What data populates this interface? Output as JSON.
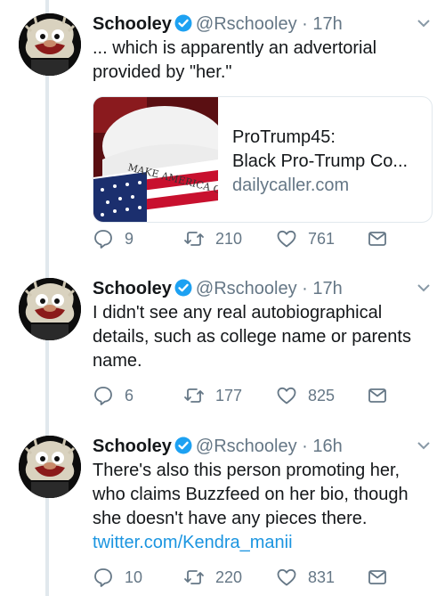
{
  "tweets": [
    {
      "name": "Schooley",
      "handle": "@Rschooley",
      "dot": "·",
      "time": "17h",
      "text_lines": [
        "... which is apparently an advertorial",
        "provided by \"her.\""
      ],
      "card": {
        "image_caption": "MAKE AMERICA GREAT AGAIN",
        "title_line1": "ProTrump45:",
        "title_line2": "Black Pro-Trump Co...",
        "domain": "dailycaller.com"
      },
      "replies": "9",
      "retweets": "210",
      "likes": "761"
    },
    {
      "name": "Schooley",
      "handle": "@Rschooley",
      "dot": "·",
      "time": "17h",
      "text_lines": [
        "I didn't see any real autobiographical",
        "details, such as college name or parents",
        "name."
      ],
      "replies": "6",
      "retweets": "177",
      "likes": "825"
    },
    {
      "name": "Schooley",
      "handle": "@Rschooley",
      "dot": "·",
      "time": "16h",
      "text_lines": [
        "There's also this person promoting her,",
        "who claims Buzzfeed on her bio, though",
        "she doesn't have any pieces there."
      ],
      "link": "twitter.com/Kendra_manii",
      "replies": "10",
      "retweets": "220",
      "likes": "831"
    }
  ],
  "colors": {
    "verified": "#1da1f2",
    "link": "#1b95e0",
    "muted": "#657786",
    "thread_line": "#e1e8ed"
  },
  "icons": [
    "verified-badge-icon",
    "chevron-down-icon",
    "reply-icon",
    "retweet-icon",
    "like-icon",
    "message-icon"
  ]
}
